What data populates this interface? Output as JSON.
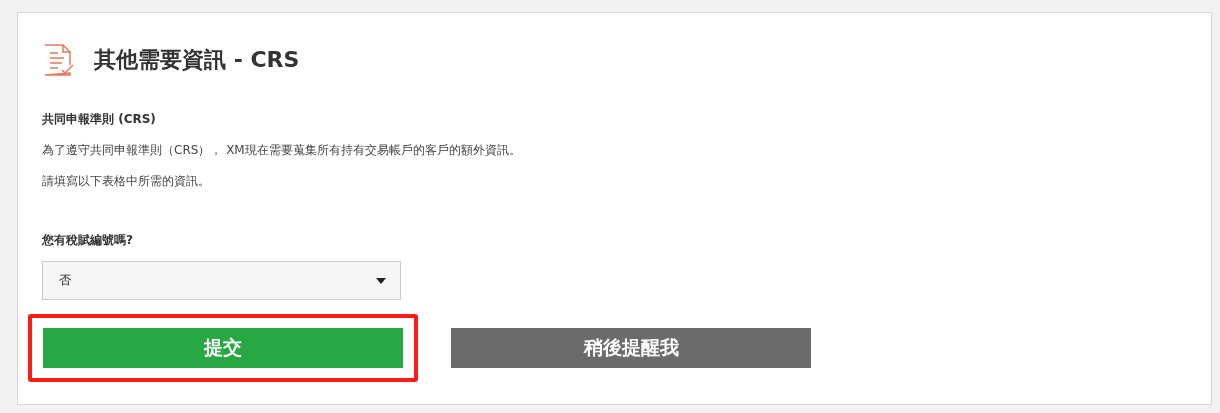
{
  "title": "其他需要資訊 - CRS",
  "section_heading": "共同申報準則 (CRS)",
  "paragraphs": [
    "為了遵守共同申報準則（CRS）， XM現在需要蒐集所有持有交易帳戶的客戶的額外資訊。",
    "請填寫以下表格中所需的資訊。"
  ],
  "question": {
    "label": "您有稅賦編號嗎?",
    "value": "否"
  },
  "buttons": [
    {
      "label": "提交",
      "kind": "primary",
      "highlighted": true
    },
    {
      "label": "稍後提醒我",
      "kind": "secondary",
      "highlighted": false
    }
  ]
}
